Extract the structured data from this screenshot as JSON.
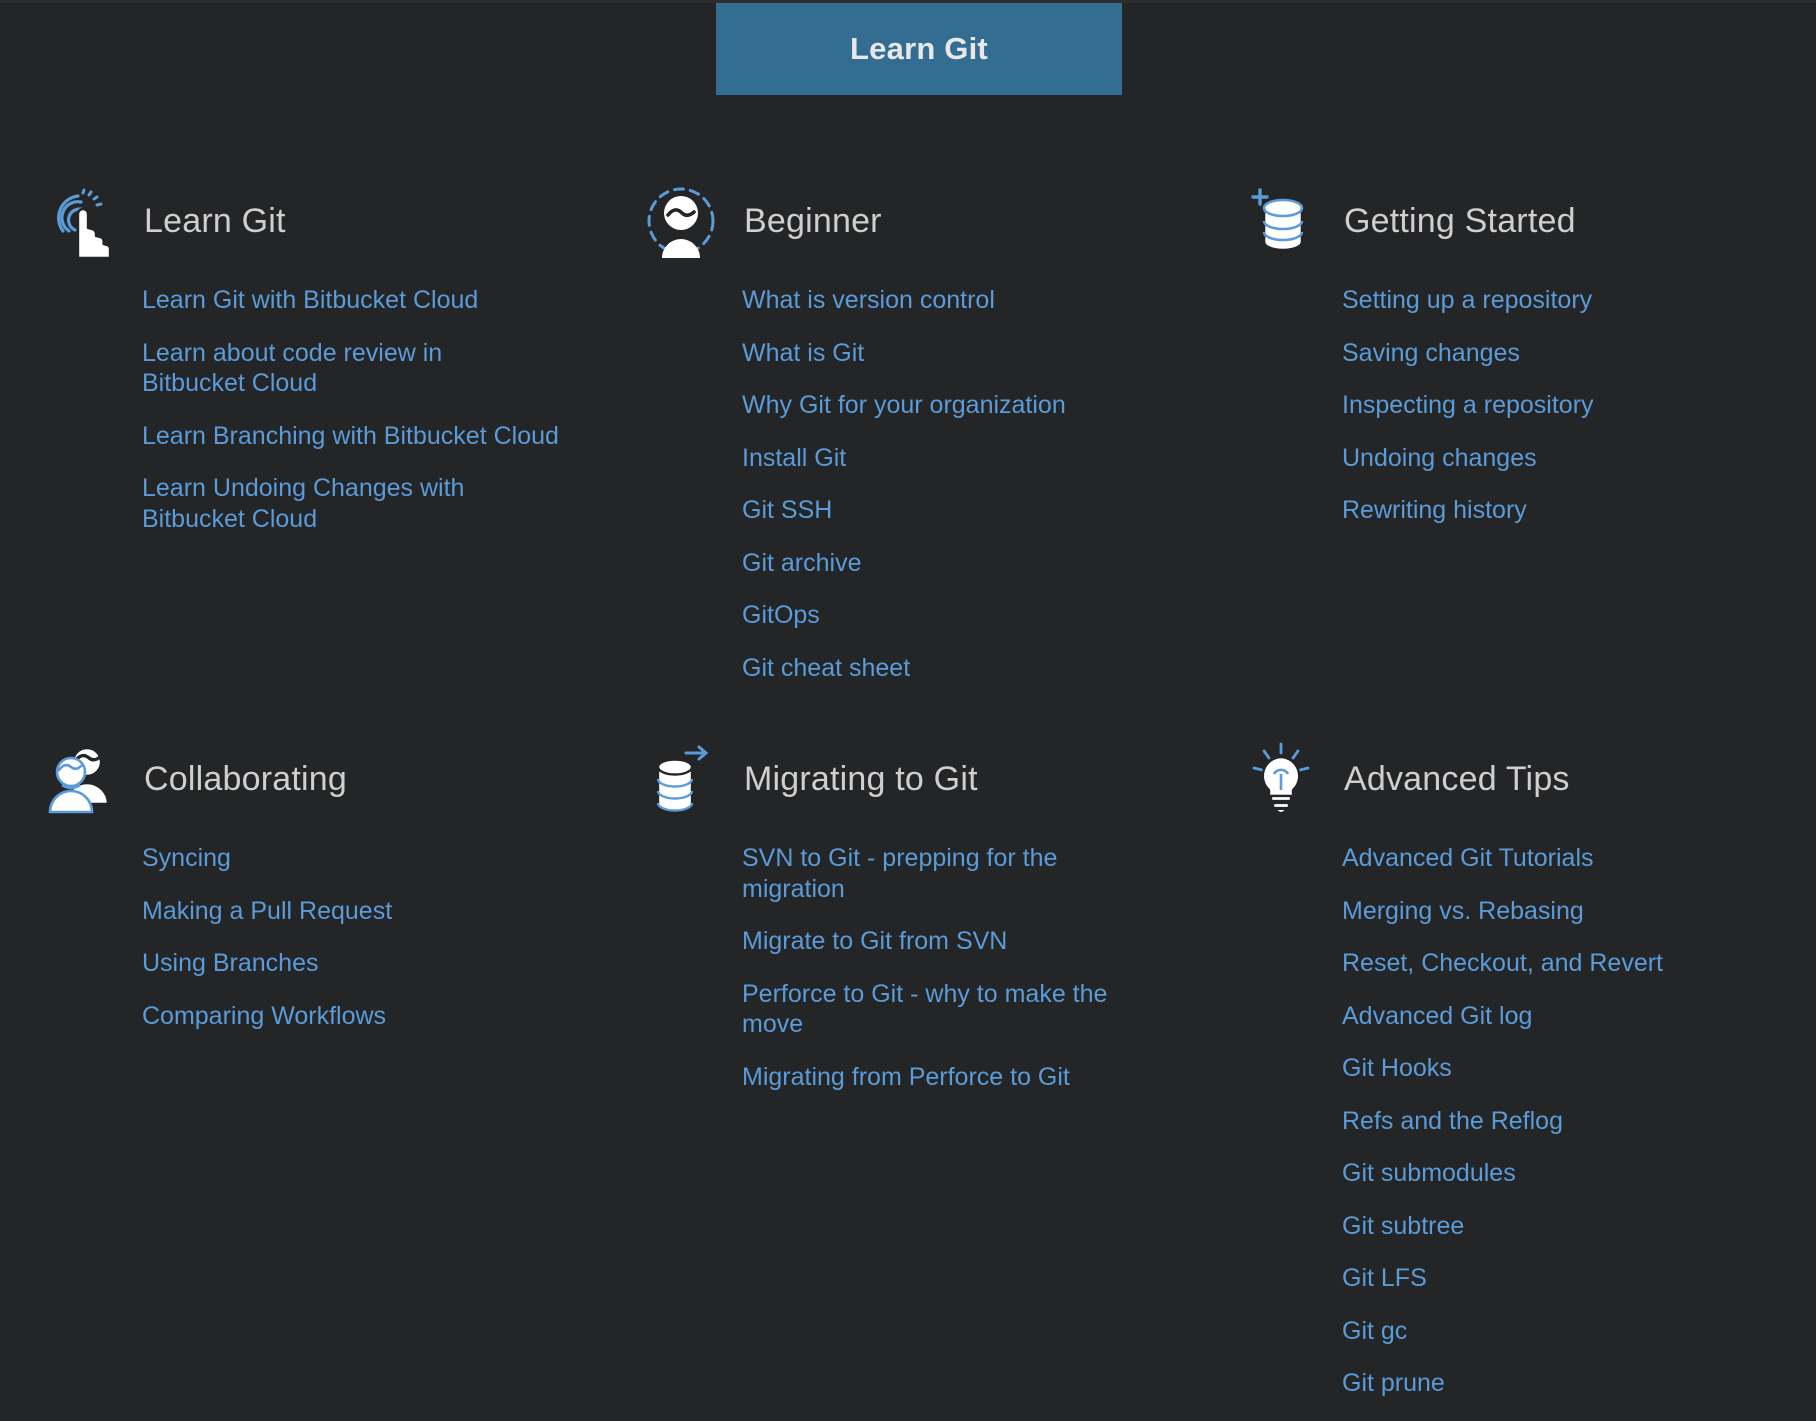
{
  "topbar": {
    "button_label": "Learn Git",
    "button_color": "#336d92"
  },
  "theme": {
    "background": "#232527",
    "link_color": "#5b9bd8",
    "heading_color": "#cfcfcf",
    "icon_accent": "#5b9bd8",
    "icon_base": "#ffffff"
  },
  "categories": [
    {
      "title": "Learn Git",
      "icon": "tap-hand-icon",
      "links": [
        "Learn Git with Bitbucket Cloud",
        "Learn about code review in Bitbucket Cloud",
        "Learn Branching with Bitbucket Cloud",
        "Learn Undoing Changes with Bitbucket Cloud"
      ]
    },
    {
      "title": "Beginner",
      "icon": "user-avatar-icon",
      "links": [
        "What is version control",
        "What is Git",
        "Why Git for your organization",
        "Install Git",
        "Git SSH",
        "Git archive",
        "GitOps",
        "Git cheat sheet"
      ]
    },
    {
      "title": "Getting Started",
      "icon": "database-plus-icon",
      "links": [
        "Setting up a repository",
        "Saving changes",
        "Inspecting a repository",
        "Undoing changes",
        "Rewriting history"
      ]
    },
    {
      "title": "Collaborating",
      "icon": "two-people-icon",
      "links": [
        "Syncing",
        "Making a Pull Request",
        "Using Branches",
        "Comparing Workflows"
      ]
    },
    {
      "title": "Migrating to Git",
      "icon": "database-arrow-icon",
      "links": [
        "SVN to Git - prepping for the migration",
        "Migrate to Git from SVN",
        "Perforce to Git - why to make the move",
        "Migrating from Perforce to Git"
      ]
    },
    {
      "title": "Advanced Tips",
      "icon": "lightbulb-icon",
      "links": [
        "Advanced Git Tutorials",
        "Merging vs. Rebasing",
        "Reset, Checkout, and Revert",
        "Advanced Git log",
        "Git Hooks",
        "Refs and the Reflog",
        "Git submodules",
        "Git subtree",
        "Git LFS",
        "Git gc",
        "Git prune"
      ]
    }
  ]
}
